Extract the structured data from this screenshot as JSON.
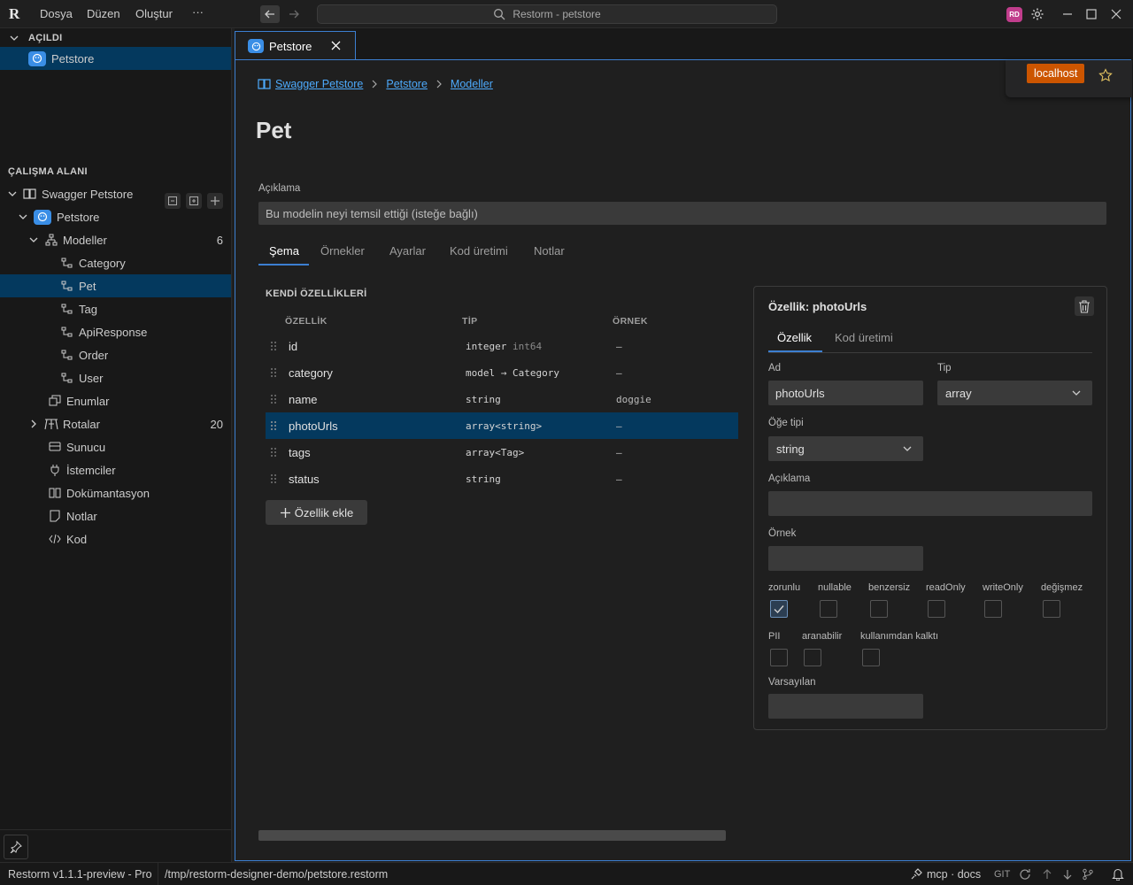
{
  "app": {
    "logo": "R",
    "menu": [
      "Dosya",
      "Düzen",
      "Oluştur",
      "···"
    ],
    "command_center": "Restorm - petstore",
    "avatar": "RD"
  },
  "sidebar": {
    "opened_title": "AÇILDI",
    "opened_item": "Petstore",
    "workspace_title": "ÇALIŞMA ALANI",
    "tree": {
      "root": "Swagger Petstore",
      "api": "Petstore",
      "models_label": "Modeller",
      "models_count": "6",
      "models": [
        "Category",
        "Pet",
        "Tag",
        "ApiResponse",
        "Order",
        "User"
      ],
      "enums": "Enumlar",
      "routes_label": "Rotalar",
      "routes_count": "20",
      "server": "Sunucu",
      "clients": "İstemciler",
      "docs": "Dokümantasyon",
      "notes": "Notlar",
      "code": "Kod"
    }
  },
  "editor_tab": {
    "label": "Petstore"
  },
  "host": {
    "label": "localhost"
  },
  "breadcrumb": [
    "Swagger Petstore",
    "Petstore",
    "Modeller"
  ],
  "page": {
    "title": "Pet",
    "description_label": "Açıklama",
    "description_placeholder": "Bu modelin neyi temsil ettiği (isteğe bağlı)",
    "tabs": [
      "Şema",
      "Örnekler",
      "Ayarlar",
      "Kod üretimi",
      "Notlar"
    ],
    "own_props_title": "KENDİ ÖZELLİKLERİ",
    "columns": [
      "ÖZELLİK",
      "TİP",
      "ÖRNEK"
    ],
    "properties": [
      {
        "name": "id",
        "type": "integer",
        "type_sub": "int64",
        "example": "—"
      },
      {
        "name": "category",
        "type": "model → Category",
        "type_sub": "",
        "example": "—"
      },
      {
        "name": "name",
        "type": "string",
        "type_sub": "",
        "example": "doggie"
      },
      {
        "name": "photoUrls",
        "type": "array<string>",
        "type_sub": "",
        "example": "—"
      },
      {
        "name": "tags",
        "type": "array<Tag>",
        "type_sub": "",
        "example": "—"
      },
      {
        "name": "status",
        "type": "string",
        "type_sub": "",
        "example": "—"
      }
    ],
    "add_property": "Özellik ekle"
  },
  "detail": {
    "title": "Özellik: photoUrls",
    "tabs": [
      "Özellik",
      "Kod üretimi"
    ],
    "name_label": "Ad",
    "name_value": "photoUrls",
    "type_label": "Tip",
    "type_value": "array",
    "item_type_label": "Öğe tipi",
    "item_type_value": "string",
    "desc_label": "Açıklama",
    "example_label": "Örnek",
    "default_label": "Varsayılan",
    "flags_row1": [
      {
        "label": "zorunlu",
        "checked": true
      },
      {
        "label": "nullable",
        "checked": false
      },
      {
        "label": "benzersiz",
        "checked": false
      },
      {
        "label": "readOnly",
        "checked": false
      },
      {
        "label": "writeOnly",
        "checked": false
      },
      {
        "label": "değişmez",
        "checked": false
      }
    ],
    "flags_row2": [
      {
        "label": "PII",
        "checked": false
      },
      {
        "label": "aranabilir",
        "checked": false
      },
      {
        "label": "kullanımdan kalktı",
        "checked": false
      }
    ]
  },
  "statusbar": {
    "version": "Restorm v1.1.1-preview - Pro",
    "path": "/tmp/restorm-designer-demo/petstore.restorm",
    "mcp": "mcp · docs",
    "git": "GIT"
  },
  "colors": {
    "accent": "#3c7fd1",
    "selection": "#04395e",
    "host_button": "#cc5500",
    "link": "#4daafc"
  }
}
